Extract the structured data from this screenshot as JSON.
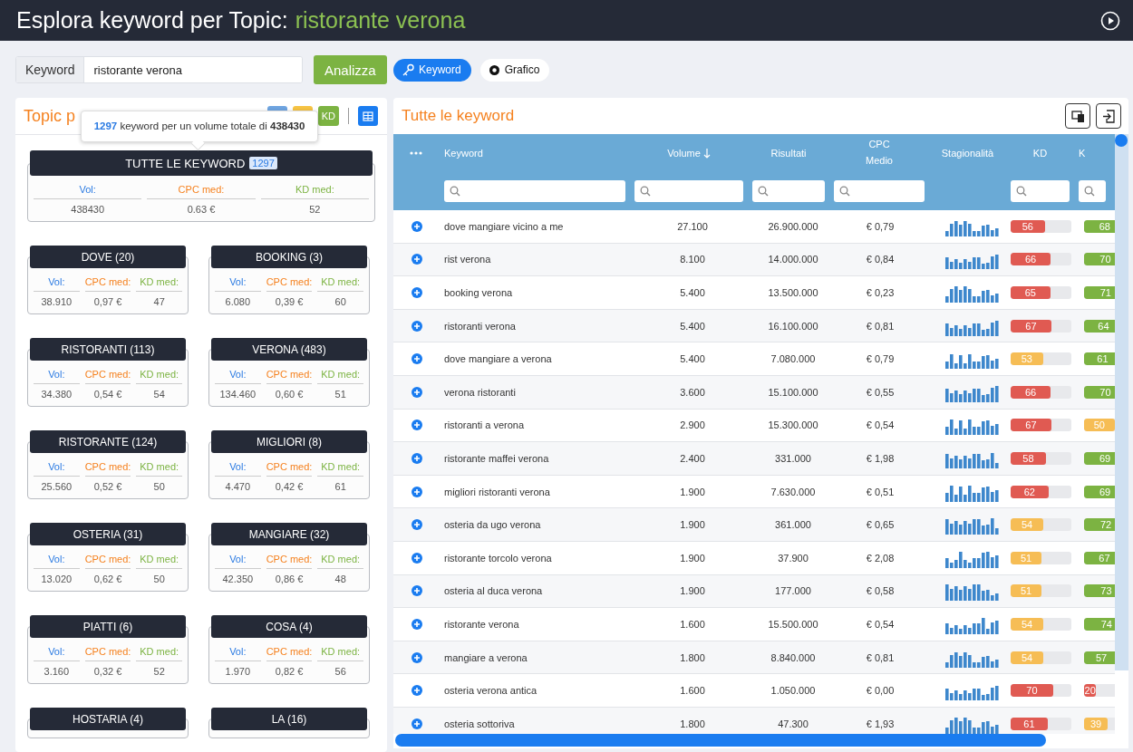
{
  "header": {
    "title": "Esplora keyword per Topic:",
    "topic": "ristorante verona"
  },
  "search": {
    "label": "Keyword",
    "value": "ristorante verona",
    "button": "Analizza"
  },
  "view_tabs": [
    {
      "label": "Keyword",
      "selected": true
    },
    {
      "label": "Grafico",
      "selected": false
    }
  ],
  "topic_panel": {
    "title": "Topic p",
    "sort_buttons": [
      {
        "color": "#6ea4e0"
      },
      {
        "color": "#f6c343"
      },
      {
        "label": "KD",
        "color": "#7cb342"
      }
    ],
    "tooltip": "**1297** keyword per un volume totale di **438430**",
    "all_keywords": {
      "title": "TUTTE LE KEYWORD",
      "count": "1297",
      "labels": [
        "Vol:",
        "CPC med:",
        "KD med:"
      ],
      "values": [
        "438430",
        "0.63 €",
        "52"
      ]
    },
    "topics": [
      {
        "title": "DOVE (20)",
        "labels": [
          "Vol:",
          "CPC med:",
          "KD med:"
        ],
        "values": [
          "38.910",
          "0,97 €",
          "47"
        ]
      },
      {
        "title": "BOOKING (3)",
        "labels": [
          "Vol:",
          "CPC med:",
          "KD med:"
        ],
        "values": [
          "6.080",
          "0,39 €",
          "60"
        ]
      },
      {
        "title": "RISTORANTI (113)",
        "labels": [
          "Vol:",
          "CPC med:",
          "KD med:"
        ],
        "values": [
          "34.380",
          "0,54 €",
          "54"
        ]
      },
      {
        "title": "VERONA (483)",
        "labels": [
          "Vol:",
          "CPC med:",
          "KD med:"
        ],
        "values": [
          "134.460",
          "0,60 €",
          "51"
        ]
      },
      {
        "title": "RISTORANTE (124)",
        "labels": [
          "Vol:",
          "CPC med:",
          "KD med:"
        ],
        "values": [
          "25.560",
          "0,52 €",
          "50"
        ]
      },
      {
        "title": "MIGLIORI (8)",
        "labels": [
          "Vol:",
          "CPC med:",
          "KD med:"
        ],
        "values": [
          "4.470",
          "0,42 €",
          "61"
        ]
      },
      {
        "title": "OSTERIA (31)",
        "labels": [
          "Vol:",
          "CPC med:",
          "KD med:"
        ],
        "values": [
          "13.020",
          "0,62 €",
          "50"
        ]
      },
      {
        "title": "MANGIARE (32)",
        "labels": [
          "Vol:",
          "CPC med:",
          "KD med:"
        ],
        "values": [
          "42.350",
          "0,86 €",
          "48"
        ]
      },
      {
        "title": "PIATTI (6)",
        "labels": [
          "Vol:",
          "CPC med:",
          "KD med:"
        ],
        "values": [
          "3.160",
          "0,32 €",
          "52"
        ]
      },
      {
        "title": "COSA (4)",
        "labels": [
          "Vol:",
          "CPC med:",
          "KD med:"
        ],
        "values": [
          "1.970",
          "0,82 €",
          "56"
        ]
      },
      {
        "title": "HOSTARIA (4)"
      },
      {
        "title": "LA (16)"
      }
    ]
  },
  "keyword_panel": {
    "title": "Tutte le keyword",
    "columns": [
      {
        "label": "Keyword",
        "sorted": false,
        "filter": true
      },
      {
        "label": "Volume",
        "sorted": true,
        "filter": true
      },
      {
        "label": "Risultati",
        "sorted": false,
        "filter": true
      },
      {
        "label": "CPC Medio",
        "sorted": false,
        "filter": true
      },
      {
        "label": "Stagionalità",
        "sorted": false,
        "filter": false
      },
      {
        "label": "KD",
        "sorted": false,
        "filter": true
      },
      {
        "label": "K",
        "sorted": false,
        "filter": true
      }
    ],
    "rows": [
      {
        "keyword": "dove mangiare vicino a me",
        "volume": "27.100",
        "results": "26.900.000",
        "cpc": "€ 0,79",
        "kd": {
          "value": "56",
          "level": 0.56,
          "color": "#e05a52"
        },
        "kc": {
          "value": "68",
          "level": 0.68,
          "color": "#7cb342"
        }
      },
      {
        "keyword": "rist verona",
        "volume": "8.100",
        "results": "14.000.000",
        "cpc": "€ 0,84",
        "kd": {
          "value": "66",
          "level": 0.66,
          "color": "#e05a52"
        },
        "kc": {
          "value": "70",
          "level": 0.7,
          "color": "#7cb342"
        }
      },
      {
        "keyword": "booking verona",
        "volume": "5.400",
        "results": "13.500.000",
        "cpc": "€ 0,23",
        "kd": {
          "value": "65",
          "level": 0.65,
          "color": "#e05a52"
        },
        "kc": {
          "value": "71",
          "level": 0.71,
          "color": "#7cb342"
        }
      },
      {
        "keyword": "ristoranti verona",
        "volume": "5.400",
        "results": "16.100.000",
        "cpc": "€ 0,81",
        "kd": {
          "value": "67",
          "level": 0.67,
          "color": "#e05a52"
        },
        "kc": {
          "value": "64",
          "level": 0.64,
          "color": "#7cb342"
        }
      },
      {
        "keyword": "dove mangiare a verona",
        "volume": "5.400",
        "results": "7.080.000",
        "cpc": "€ 0,79",
        "kd": {
          "value": "53",
          "level": 0.53,
          "color": "#f6bd55"
        },
        "kc": {
          "value": "61",
          "level": 0.61,
          "color": "#7cb342"
        }
      },
      {
        "keyword": "verona ristoranti",
        "volume": "3.600",
        "results": "15.100.000",
        "cpc": "€ 0,55",
        "kd": {
          "value": "66",
          "level": 0.66,
          "color": "#e05a52"
        },
        "kc": {
          "value": "70",
          "level": 0.7,
          "color": "#7cb342"
        }
      },
      {
        "keyword": "ristoranti a verona",
        "volume": "2.900",
        "results": "15.300.000",
        "cpc": "€ 0,54",
        "kd": {
          "value": "67",
          "level": 0.67,
          "color": "#e05a52"
        },
        "kc": {
          "value": "50",
          "level": 0.5,
          "color": "#f6bd55"
        }
      },
      {
        "keyword": "ristorante maffei verona",
        "volume": "2.400",
        "results": "331.000",
        "cpc": "€ 1,98",
        "kd": {
          "value": "58",
          "level": 0.58,
          "color": "#e05a52"
        },
        "kc": {
          "value": "69",
          "level": 0.69,
          "color": "#7cb342"
        }
      },
      {
        "keyword": "migliori ristoranti verona",
        "volume": "1.900",
        "results": "7.630.000",
        "cpc": "€ 0,51",
        "kd": {
          "value": "62",
          "level": 0.62,
          "color": "#e05a52"
        },
        "kc": {
          "value": "69",
          "level": 0.69,
          "color": "#7cb342"
        }
      },
      {
        "keyword": "osteria da ugo verona",
        "volume": "1.900",
        "results": "361.000",
        "cpc": "€ 0,65",
        "kd": {
          "value": "54",
          "level": 0.54,
          "color": "#f6bd55"
        },
        "kc": {
          "value": "72",
          "level": 0.72,
          "color": "#7cb342"
        }
      },
      {
        "keyword": "ristorante torcolo verona",
        "volume": "1.900",
        "results": "37.900",
        "cpc": "€ 2,08",
        "kd": {
          "value": "51",
          "level": 0.51,
          "color": "#f6bd55"
        },
        "kc": {
          "value": "67",
          "level": 0.67,
          "color": "#7cb342"
        }
      },
      {
        "keyword": "osteria al duca verona",
        "volume": "1.900",
        "results": "177.000",
        "cpc": "€ 0,58",
        "kd": {
          "value": "51",
          "level": 0.51,
          "color": "#f6bd55"
        },
        "kc": {
          "value": "73",
          "level": 0.73,
          "color": "#7cb342"
        }
      },
      {
        "keyword": "ristorante verona",
        "volume": "1.600",
        "results": "15.500.000",
        "cpc": "€ 0,54",
        "kd": {
          "value": "54",
          "level": 0.54,
          "color": "#f6bd55"
        },
        "kc": {
          "value": "74",
          "level": 0.74,
          "color": "#7cb342"
        }
      },
      {
        "keyword": "mangiare a verona",
        "volume": "1.800",
        "results": "8.840.000",
        "cpc": "€ 0,81",
        "kd": {
          "value": "54",
          "level": 0.54,
          "color": "#f6bd55"
        },
        "kc": {
          "value": "57",
          "level": 0.57,
          "color": "#7cb342"
        }
      },
      {
        "keyword": "osteria verona antica",
        "volume": "1.600",
        "results": "1.050.000",
        "cpc": "€ 0,00",
        "kd": {
          "value": "70",
          "level": 0.7,
          "color": "#e05a52"
        },
        "kc": {
          "value": "20",
          "level": 0.2,
          "color": "#e05a52"
        }
      },
      {
        "keyword": "osteria sottoriva",
        "volume": "1.800",
        "results": "47.300",
        "cpc": "€ 1,93",
        "kd": {
          "value": "61",
          "level": 0.61,
          "color": "#e05a52"
        },
        "kc": {
          "value": "39",
          "level": 0.39,
          "color": "#f6bd55"
        }
      }
    ]
  }
}
